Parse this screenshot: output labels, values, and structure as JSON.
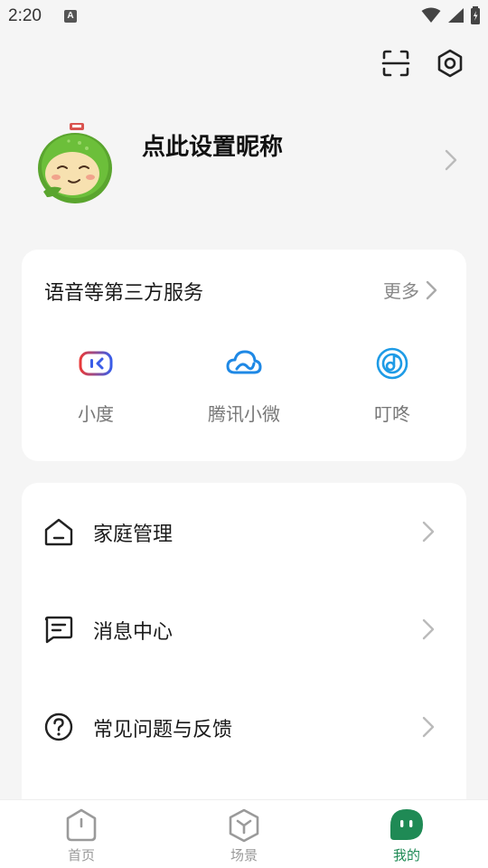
{
  "status_bar": {
    "time": "2:20",
    "notification_letter": "A"
  },
  "profile": {
    "nickname": "点此设置昵称"
  },
  "services": {
    "title": "语音等第三方服务",
    "more_label": "更多",
    "items": [
      {
        "label": "小度",
        "icon": "xiaodu-icon"
      },
      {
        "label": "腾讯小微",
        "icon": "tencent-xiaowei-icon"
      },
      {
        "label": "叮咚",
        "icon": "dingdong-icon"
      }
    ]
  },
  "menu": {
    "items": [
      {
        "label": "家庭管理",
        "icon": "home-icon"
      },
      {
        "label": "消息中心",
        "icon": "message-icon"
      },
      {
        "label": "常见问题与反馈",
        "icon": "help-icon"
      }
    ]
  },
  "bottom_nav": {
    "items": [
      {
        "label": "首页",
        "icon": "home-tab-icon",
        "active": false
      },
      {
        "label": "场景",
        "icon": "scene-tab-icon",
        "active": false
      },
      {
        "label": "我的",
        "icon": "mine-tab-icon",
        "active": true
      }
    ]
  },
  "colors": {
    "accent": "#1f8a55",
    "background": "#f5f5f5",
    "card": "#ffffff"
  }
}
